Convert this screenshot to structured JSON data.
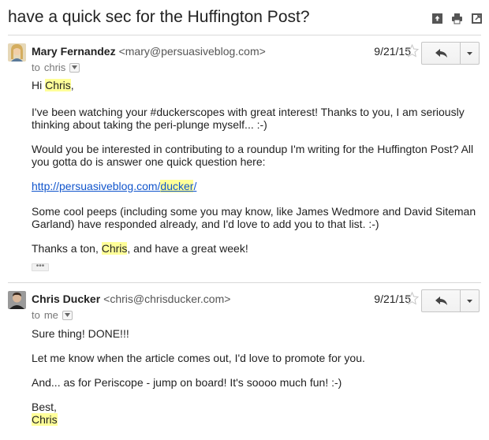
{
  "subject": "have a quick sec for the Huffington Post?",
  "top_actions": [
    "archive-icon",
    "print-icon",
    "new-window-icon"
  ],
  "messages": [
    {
      "sender_name": "Mary Fernandez",
      "sender_email": "<mary@persuasiveblog.com>",
      "to_prefix": "to",
      "to_name": "chris",
      "date": "9/21/15",
      "greeting_a": "Hi ",
      "greeting_name": "Chris",
      "greeting_b": ",",
      "p1_line1": "I've been watching your #duckerscopes with great interest! Thanks to you, I am seriously",
      "p1_line2": "thinking about taking the peri-plunge myself... :-)",
      "p2_line1": "Would you be interested in contributing to a roundup I'm writing for the Huffington Post? All",
      "p2_line2": "you gotta do is answer one quick question here:",
      "link_a": "http://persuasiveblog.com/",
      "link_b": "ducker",
      "link_c": "/",
      "p3_line1": "Some cool peeps (including some you may know, like James Wedmore and David Siteman",
      "p3_line2": "Garland) have responded already, and I'd love to add you to that list. :-)",
      "closing_a": "Thanks a ton, ",
      "closing_name": "Chris",
      "closing_b": ", and have a great week!",
      "ellipsis": "•••"
    },
    {
      "sender_name": "Chris Ducker",
      "sender_email": "<chris@chrisducker.com>",
      "to_prefix": "to",
      "to_name": "me",
      "date": "9/21/15",
      "line1": "Sure thing! DONE!!!",
      "line2": "Let me know when the article comes out, I'd love to promote for you.",
      "line3": "And... as for Periscope - jump on board! It's soooo much fun! :-)",
      "line4": "Best,",
      "signature": "Chris"
    }
  ],
  "colors": {
    "highlight": "#ffff99",
    "link": "#1155cc",
    "divider": "#d9d9d9"
  }
}
